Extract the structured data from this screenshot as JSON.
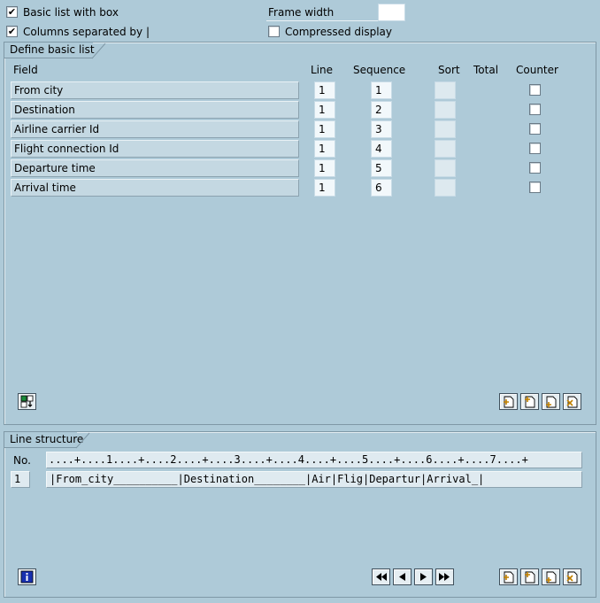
{
  "options": {
    "basic_list_with_box": {
      "label": "Basic list with box",
      "checked": true
    },
    "columns_separated": {
      "label": "Columns separated by |",
      "checked": true
    },
    "frame_width": {
      "label": "Frame width",
      "value": ""
    },
    "compressed_display": {
      "label": "Compressed display",
      "checked": false
    }
  },
  "define_basic_list": {
    "title": "Define basic list",
    "headers": {
      "field": "Field",
      "line": "Line",
      "sequence": "Sequence",
      "sort": "Sort",
      "total": "Total",
      "counter": "Counter"
    },
    "rows": [
      {
        "field": "From city",
        "line": "1",
        "sequence": "1",
        "sort": "",
        "counter": false
      },
      {
        "field": "Destination",
        "line": "1",
        "sequence": "2",
        "sort": "",
        "counter": false
      },
      {
        "field": "Airline carrier Id",
        "line": "1",
        "sequence": "3",
        "sort": "",
        "counter": false
      },
      {
        "field": "Flight connection Id",
        "line": "1",
        "sequence": "4",
        "sort": "",
        "counter": false
      },
      {
        "field": "Departure time",
        "line": "1",
        "sequence": "5",
        "sort": "",
        "counter": false
      },
      {
        "field": "Arrival time",
        "line": "1",
        "sequence": "6",
        "sort": "",
        "counter": false
      }
    ]
  },
  "line_structure": {
    "title": "Line structure",
    "no_header": "No.",
    "ruler": "....+....1....+....2....+....3....+....4....+....5....+....6....+....7....+",
    "lines": [
      {
        "no": "1",
        "text": "|From_city__________|Destination________|Air|Flig|Departur|Arrival_|"
      }
    ]
  },
  "icons": {
    "top_left": "select-fields-icon",
    "top_right": [
      "insert-line-icon",
      "insert-line-above-icon",
      "insert-line-below-icon",
      "delete-line-icon"
    ],
    "bottom_left": "info-icon",
    "nav": [
      "first-page-icon",
      "previous-page-icon",
      "next-page-icon",
      "last-page-icon"
    ],
    "bottom_right": [
      "insert-line-icon",
      "insert-line-above-icon",
      "insert-line-below-icon",
      "delete-line-icon"
    ]
  }
}
